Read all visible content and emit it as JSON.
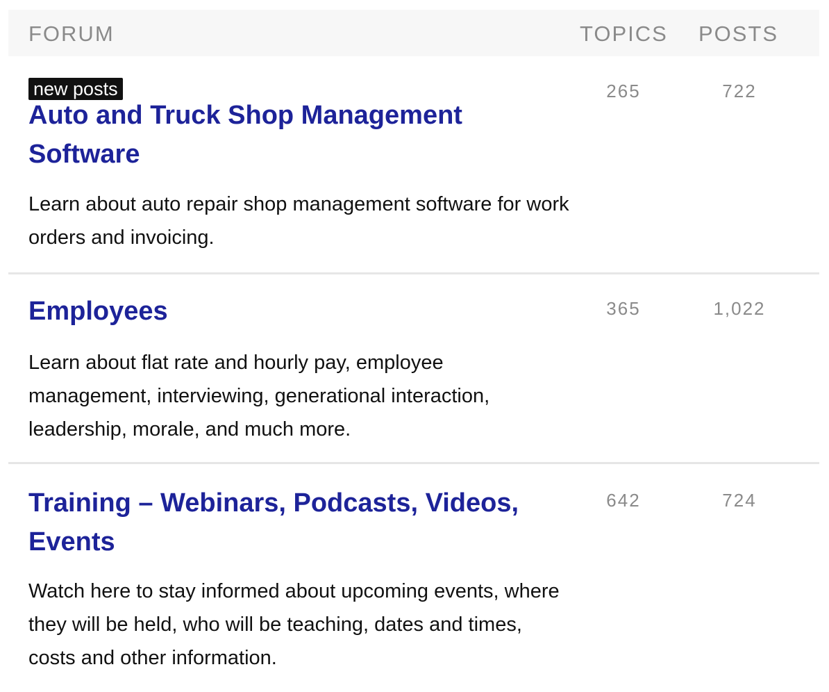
{
  "header": {
    "forum_label": "FORUM",
    "topics_label": "TOPICS",
    "posts_label": "POSTS"
  },
  "forums": [
    {
      "badge": "new posts",
      "title": "Auto and Truck Shop Management Software",
      "description": "Learn about auto repair shop management software for work orders and invoicing.",
      "topics": "265",
      "posts": "722"
    },
    {
      "title": "Employees",
      "description": "Learn about flat rate and hourly pay, employee management, interviewing, generational interaction, leadership, morale, and much more.",
      "topics": "365",
      "posts": "1,022"
    },
    {
      "title": "Training – Webinars, Podcasts, Videos, Events",
      "description": "Watch here to stay informed about upcoming events, where they will be held, who will be teaching, dates and times, costs and other information.",
      "topics": "642",
      "posts": "724"
    }
  ],
  "colors": {
    "link": "#1d2399",
    "header_bg": "#f7f7f7",
    "muted_text": "#8a8a8a",
    "badge_bg": "#111111",
    "divider": "#e6e6e6"
  }
}
